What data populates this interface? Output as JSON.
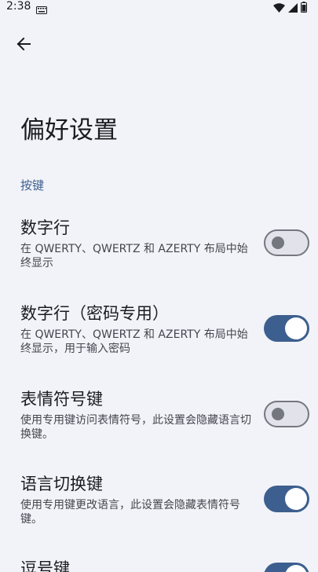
{
  "status": {
    "time": "2:38"
  },
  "page": {
    "title": "偏好设置"
  },
  "section": {
    "keys": "按键"
  },
  "prefs": [
    {
      "title": "数字行",
      "summary": "在 QWERTY、QWERTZ 和 AZERTY 布局中始终显示",
      "enabled": false
    },
    {
      "title": "数字行（密码专用）",
      "summary": "在 QWERTY、QWERTZ 和 AZERTY 布局中始终显示，用于输入密码",
      "enabled": true
    },
    {
      "title": "表情符号键",
      "summary": "使用专用键访问表情符号，此设置会隐藏语言切换键。",
      "enabled": false
    },
    {
      "title": "语言切换键",
      "summary": "使用专用键更改语言，此设置会隐藏表情符号键。",
      "enabled": true
    },
    {
      "title": "逗号键",
      "summary": "",
      "enabled": true
    }
  ]
}
